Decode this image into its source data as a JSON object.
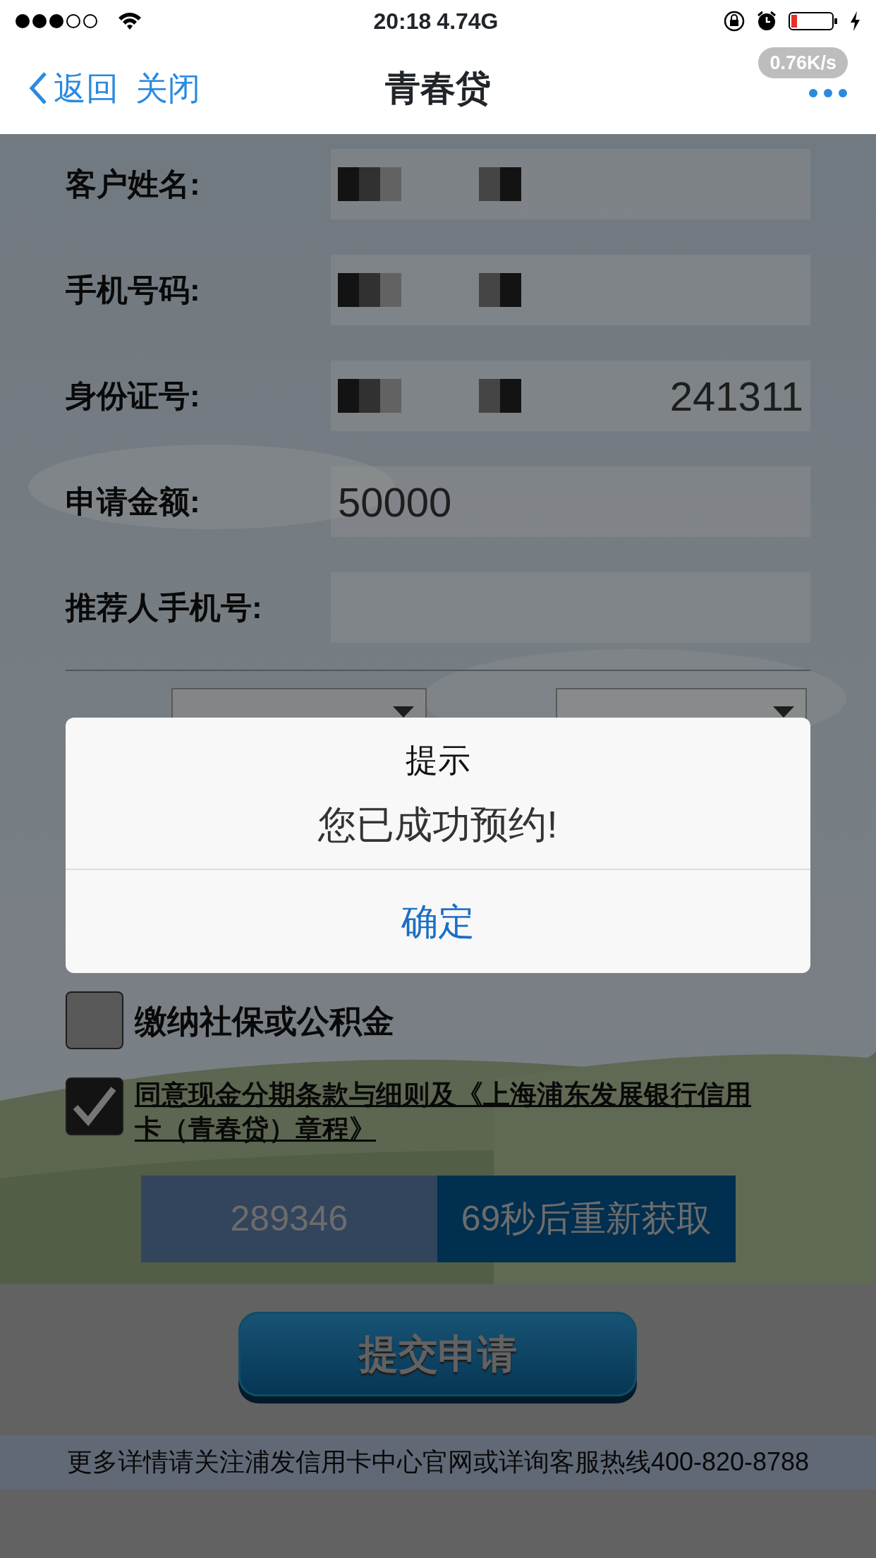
{
  "status_bar": {
    "time": "20:18",
    "data_usage": "4.74G",
    "speed_badge": "0.76K/s"
  },
  "nav": {
    "back": "返回",
    "close": "关闭",
    "title": "青春贷"
  },
  "form": {
    "fields": [
      {
        "label": "客户姓名:",
        "masked": true
      },
      {
        "label": "手机号码:",
        "masked": true
      },
      {
        "label": "身份证号:",
        "masked": true,
        "value": "241311"
      },
      {
        "label": "申请金额:",
        "masked": false,
        "value": "50000"
      },
      {
        "label": "推荐人手机号:",
        "masked": false
      }
    ],
    "agreements": [
      {
        "kind": "plain",
        "label": "缴纳社保或公积金",
        "checked": false
      },
      {
        "kind": "link",
        "label": "同意现金分期条款与细则及《上海浦东发展银行信用卡（青春贷）章程》",
        "checked": true
      }
    ],
    "verification": {
      "code": "289346",
      "resend": "69秒后重新获取"
    },
    "submit": "提交申请"
  },
  "footer": "更多详情请关注浦发信用卡中心官网或详询客服热线400-820-8788",
  "dialog": {
    "title": "提示",
    "message": "您已成功预约!",
    "button": "确定"
  }
}
